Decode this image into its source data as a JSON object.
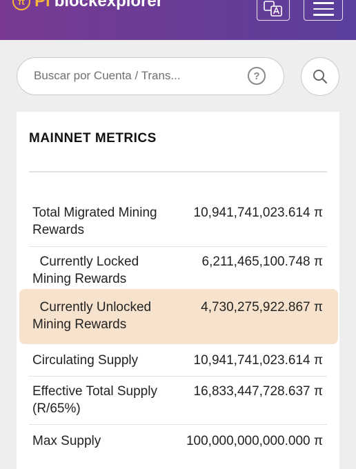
{
  "header": {
    "logo_mark": "π",
    "logo_pi": "Pi",
    "logo_text": "blockexplorer"
  },
  "search": {
    "placeholder": "Buscar por Cuenta / Trans...",
    "help_glyph": "?"
  },
  "metrics": {
    "title": "MAINNET METRICS",
    "rows": [
      {
        "label": "Total Migrated Mining Rewards",
        "value": "10,941,741,023.614 π"
      },
      {
        "label": "  Currently Locked Mining Rewards",
        "value": "6,211,465,100.748 π"
      },
      {
        "label": "  Currently Unlocked Mining Rewards",
        "value": "4,730,275,922.867 π"
      },
      {
        "label": "Circulating Supply",
        "value": "10,941,741,023.614 π"
      },
      {
        "label": "Effective Total Supply (R/65%)",
        "value": "16,833,447,728.637 π"
      },
      {
        "label": "Max Supply",
        "value": "100,000,000,000.000 π"
      }
    ]
  },
  "colors": {
    "header_gradient_start": "#7a3a94",
    "header_gradient_end": "#5b3f9c",
    "brand_accent": "#f5b43a",
    "highlight_row": "#f7e3cd"
  },
  "icons": {
    "language": "translate-icon",
    "menu": "hamburger-menu-icon",
    "help": "question-circle-icon",
    "search": "magnifier-icon"
  }
}
